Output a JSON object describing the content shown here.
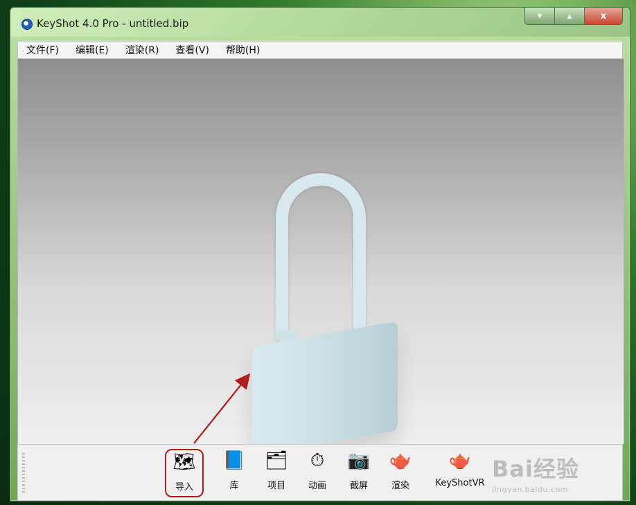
{
  "window": {
    "title": "KeyShot 4.0 Pro  - untitled.bip",
    "controls": [
      "▾",
      "▴",
      "x"
    ]
  },
  "menu": {
    "items": [
      "文件(F)",
      "编辑(E)",
      "渲染(R)",
      "查看(V)",
      "帮助(H)"
    ]
  },
  "toolbar": {
    "items": [
      {
        "label": "导入",
        "icon": "import-icon",
        "glyph": "🗺"
      },
      {
        "label": "库",
        "icon": "library-icon",
        "glyph": "📘"
      },
      {
        "label": "项目",
        "icon": "project-icon",
        "glyph": "🗂"
      },
      {
        "label": "动画",
        "icon": "animation-icon",
        "glyph": "⏱"
      },
      {
        "label": "截屏",
        "icon": "screenshot-icon",
        "glyph": "📷"
      },
      {
        "label": "渲染",
        "icon": "render-teapot-icon",
        "glyph": "🫖"
      },
      {
        "label": "KeyShotVR",
        "icon": "keyshotvr-icon",
        "glyph": "🫖"
      }
    ]
  },
  "watermark": {
    "main": "Bai经验",
    "sub": "jingyan.baidu.com"
  },
  "colors": {
    "annotation_red": "#b11d1d",
    "window_border_green": "#3f6e3a",
    "menubar_bg": "#f4f4f4",
    "toolbar_bg": "#f0f0f0"
  }
}
